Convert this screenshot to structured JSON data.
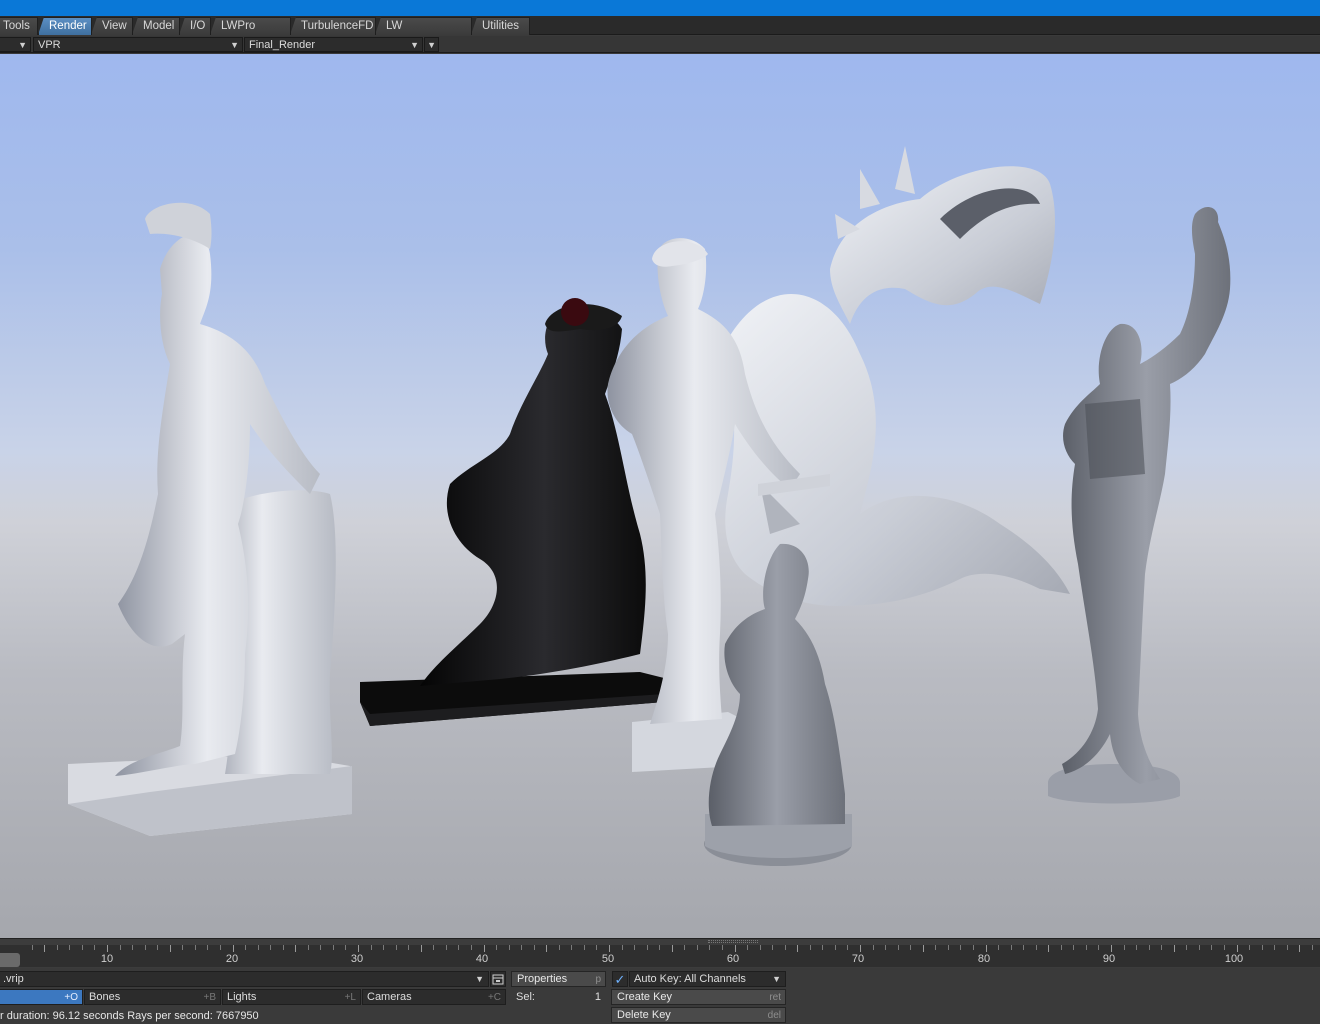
{
  "tabs": [
    {
      "label": "Tools",
      "active": false
    },
    {
      "label": "Render",
      "active": true
    },
    {
      "label": "View",
      "active": false
    },
    {
      "label": "Model",
      "active": false
    },
    {
      "label": "I/O",
      "active": false
    },
    {
      "label": "LWPro Tools",
      "active": false
    },
    {
      "label": "TurbulenceFD",
      "active": false
    },
    {
      "label": "LW Workspaces",
      "active": false
    },
    {
      "label": "Utilities",
      "active": false
    }
  ],
  "viewport_toolbar": {
    "view_mode": "VPR",
    "render_preset": "Final_Render"
  },
  "timeline": {
    "tick_labels": [
      "10",
      "20",
      "30",
      "40",
      "50",
      "60",
      "70",
      "80",
      "90",
      "100"
    ]
  },
  "bottom_bar": {
    "scene_file": ".vrip",
    "objects_shortcut": "+O",
    "bones": {
      "label": "Bones",
      "shortcut": "+B"
    },
    "lights": {
      "label": "Lights",
      "shortcut": "+L"
    },
    "cameras": {
      "label": "Cameras",
      "shortcut": "+C"
    },
    "properties": {
      "label": "Properties",
      "shortcut": "p"
    },
    "sel": {
      "label": "Sel:",
      "value": "1"
    },
    "auto_key": {
      "checked": true,
      "label": "Auto Key: All Channels"
    },
    "create_key": {
      "label": "Create Key",
      "shortcut": "ret"
    },
    "delete_key": {
      "label": "Delete Key",
      "shortcut": "del"
    }
  },
  "status": {
    "text": "r duration: 96.12 seconds  Rays per second: 7667950"
  },
  "colors": {
    "title_bar": "#0a78d7",
    "active_tab": "#4b7fb3",
    "selected_field": "#3c78c0"
  }
}
